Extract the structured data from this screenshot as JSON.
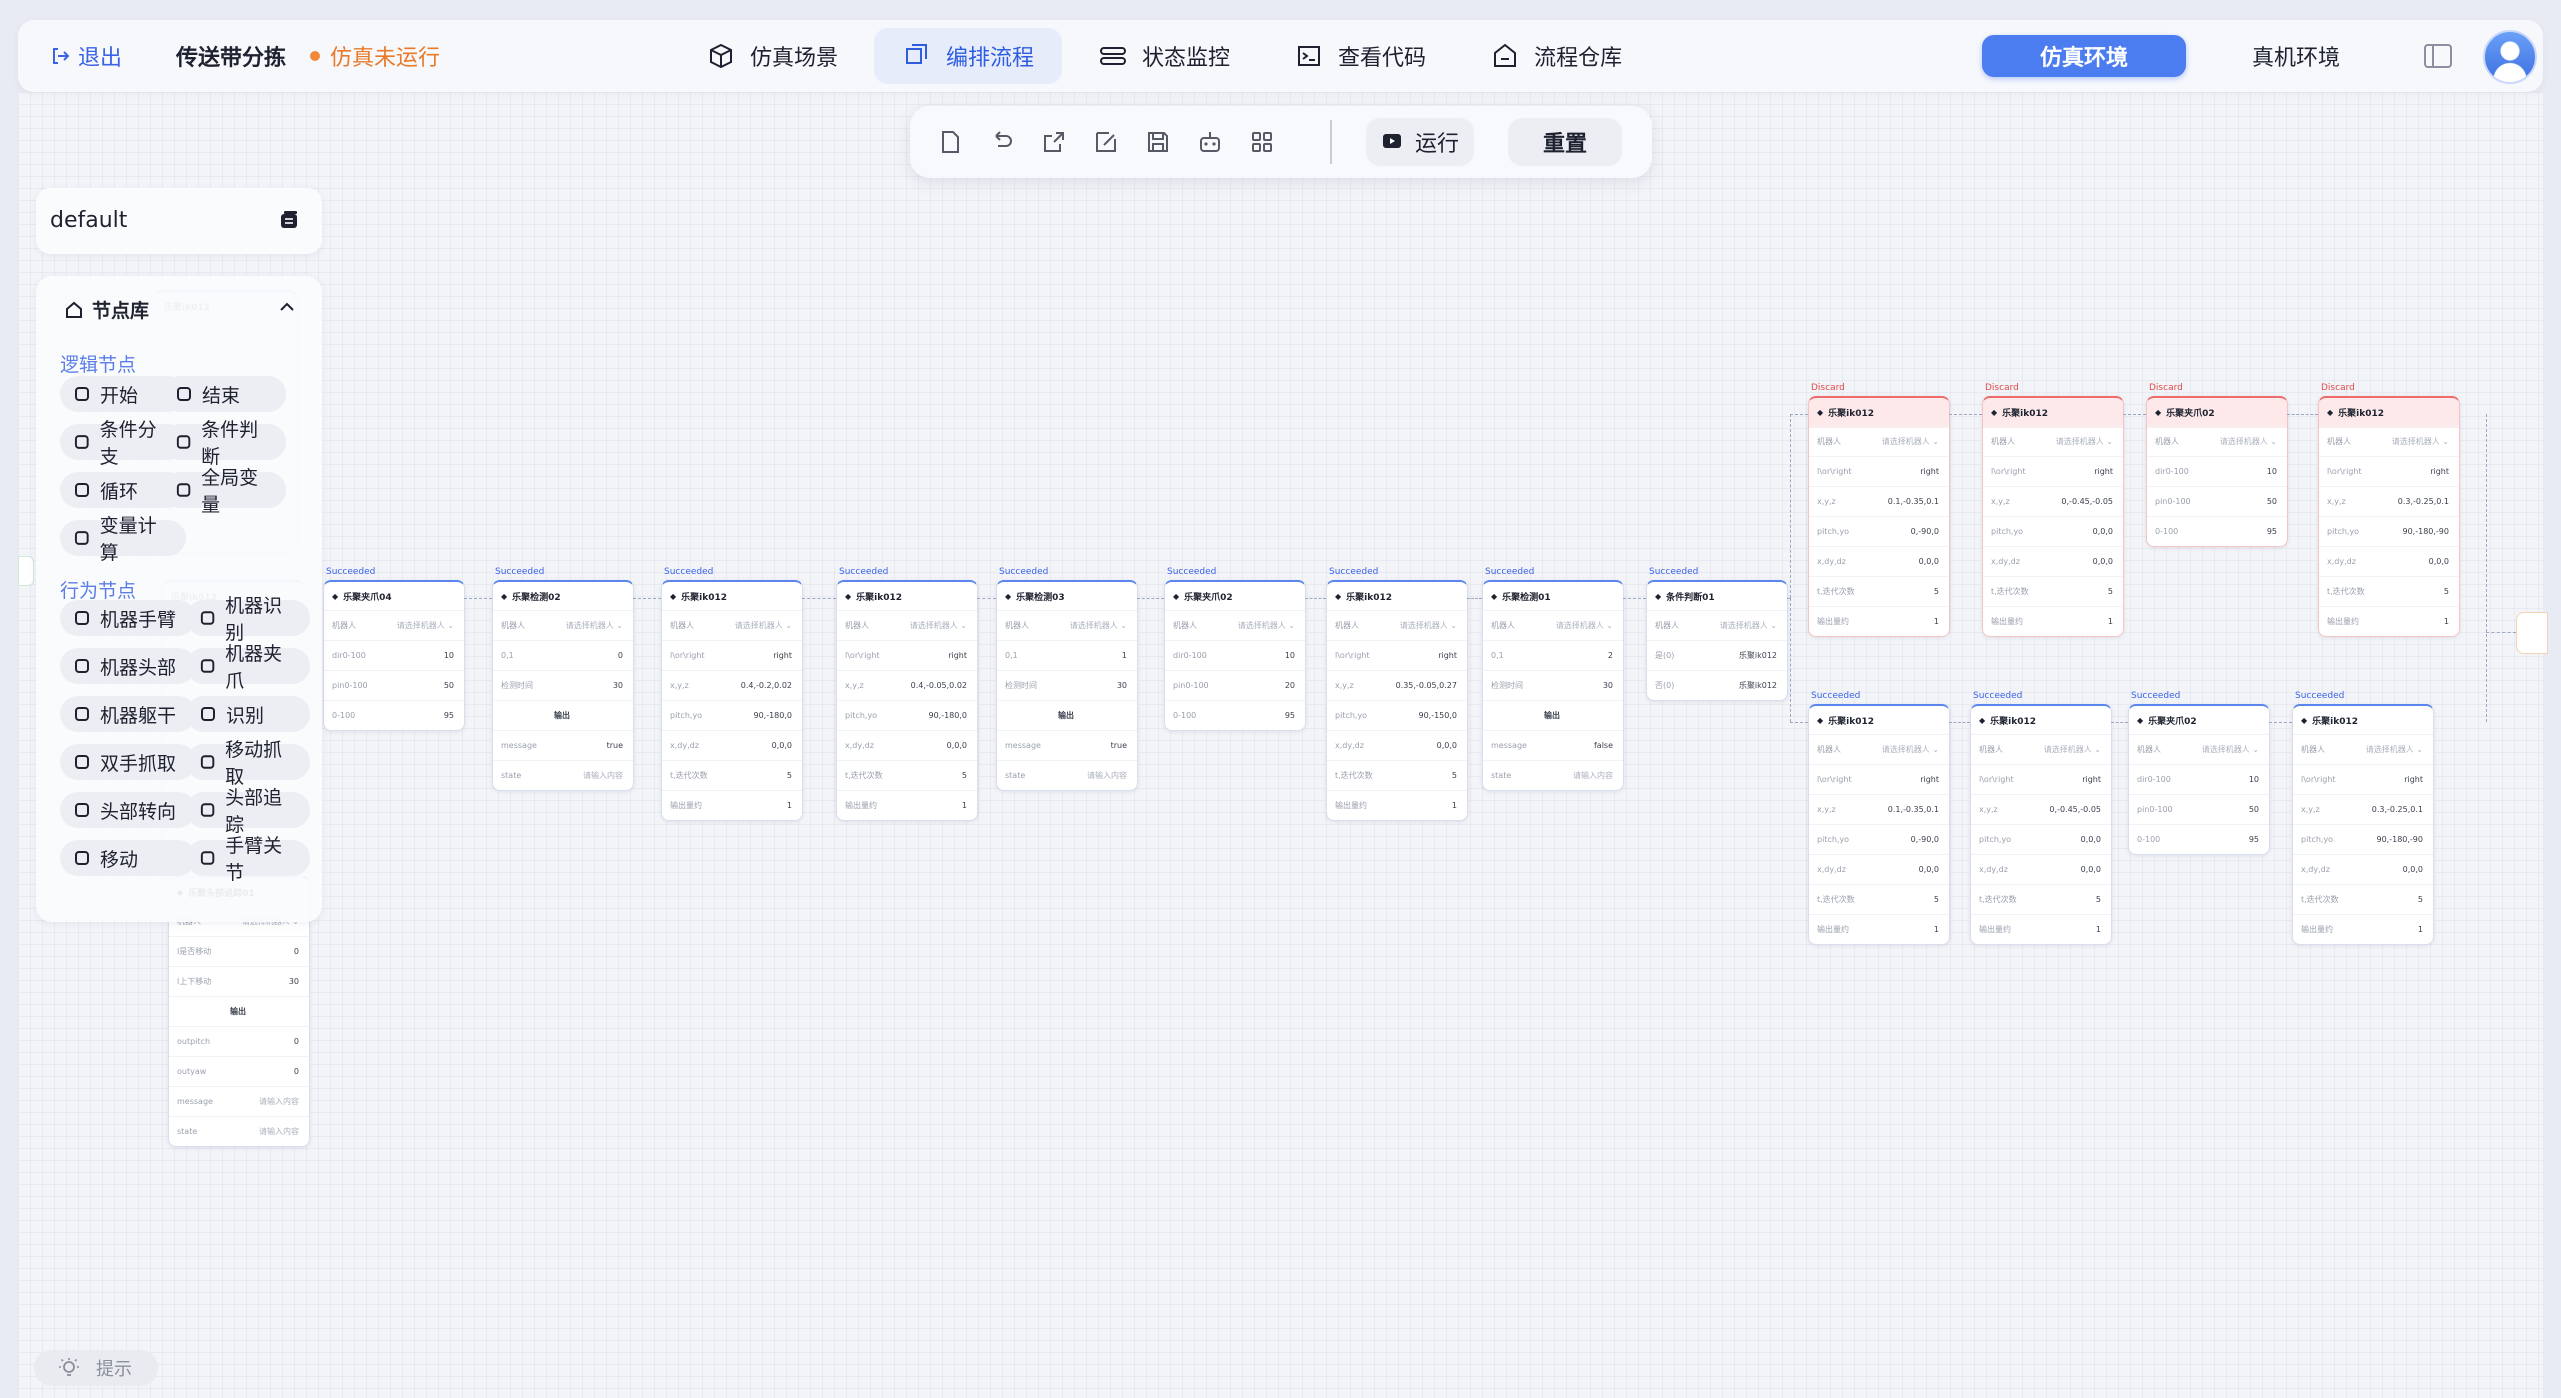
{
  "header": {
    "exit_label": "退出",
    "project_title": "传送带分拣",
    "status_text": "仿真未运行",
    "status_color": "#ea7a29",
    "nav": [
      {
        "label": "仿真场景",
        "icon": "cube-icon",
        "active": false
      },
      {
        "label": "编排流程",
        "icon": "flow-icon",
        "active": true
      },
      {
        "label": "状态监控",
        "icon": "monitor-icon",
        "active": false
      },
      {
        "label": "查看代码",
        "icon": "terminal-icon",
        "active": false
      },
      {
        "label": "流程仓库",
        "icon": "repo-icon",
        "active": false
      }
    ],
    "env_sim": "仿真环境",
    "env_real": "真机环境",
    "accent_color": "#4b7cf0"
  },
  "toolbar": {
    "icons": [
      "new-file-icon",
      "undo-icon",
      "export-icon",
      "edit-icon",
      "save-icon",
      "robot-icon",
      "grid-icon"
    ],
    "run_label": "运行",
    "reset_label": "重置"
  },
  "workspace": {
    "name": "default"
  },
  "library": {
    "title": "节点库",
    "logic_section": "逻辑节点",
    "logic_nodes": [
      "开始",
      "结束",
      "条件分支",
      "条件判断",
      "循环",
      "全局变量",
      "变量计算"
    ],
    "action_section": "行为节点",
    "action_nodes": [
      "机器手臂",
      "机器识别",
      "机器头部",
      "机器夹爪",
      "机器躯干",
      "识别",
      "双手抓取",
      "移动抓取",
      "头部转向",
      "头部追踪",
      "移动",
      "手臂关节"
    ]
  },
  "hint_label": "提示",
  "flow": {
    "succeeded": "Succeeded",
    "discard": "Discard",
    "output_label": "输出",
    "robot_label": "机器人",
    "robot_placeholder": "请选择机器人",
    "input_placeholder": "请输入内容",
    "nodes": [
      {
        "title": "乐聚夹爪04",
        "rows": [
          [
            "dir0-100",
            "10"
          ],
          [
            "pin0-100",
            "50"
          ],
          [
            "0-100",
            "95"
          ]
        ]
      },
      {
        "title": "乐聚检测02",
        "rows": [
          [
            "0,1",
            "0"
          ],
          [
            "检测时间",
            "30"
          ]
        ],
        "output": [
          [
            "message",
            "true"
          ],
          [
            "state",
            "请输入内容"
          ]
        ]
      },
      {
        "title": "乐聚ik012",
        "rows": [
          [
            "l\\or\\right",
            "right"
          ],
          [
            "x,y,z",
            "0.4,-0.2,0.02"
          ],
          [
            "pitch,yo",
            "90,-180,0"
          ],
          [
            "x,dy,dz",
            "0,0,0"
          ],
          [
            "t,迭代次数",
            "5"
          ],
          [
            "输出量约",
            "1"
          ]
        ]
      },
      {
        "title": "乐聚ik012",
        "rows": [
          [
            "l\\or\\right",
            "right"
          ],
          [
            "x,y,z",
            "0.4,-0.05,0.02"
          ],
          [
            "pitch,yo",
            "90,-180,0"
          ],
          [
            "x,dy,dz",
            "0,0,0"
          ],
          [
            "t,迭代次数",
            "5"
          ],
          [
            "输出量约",
            "1"
          ]
        ]
      },
      {
        "title": "乐聚检测03",
        "rows": [
          [
            "0,1",
            "1"
          ],
          [
            "检测时间",
            "30"
          ]
        ],
        "output": [
          [
            "message",
            "true"
          ],
          [
            "state",
            "请输入内容"
          ]
        ]
      },
      {
        "title": "乐聚夹爪02",
        "rows": [
          [
            "dir0-100",
            "10"
          ],
          [
            "pin0-100",
            "20"
          ],
          [
            "0-100",
            "95"
          ]
        ]
      },
      {
        "title": "乐聚ik012",
        "rows": [
          [
            "l\\or\\right",
            "right"
          ],
          [
            "x,y,z",
            "0.35,-0.05,0.27"
          ],
          [
            "pitch,yo",
            "90,-150,0"
          ],
          [
            "x,dy,dz",
            "0,0,0"
          ],
          [
            "t,迭代次数",
            "5"
          ],
          [
            "输出量约",
            "1"
          ]
        ]
      },
      {
        "title": "乐聚检测01",
        "rows": [
          [
            "0,1",
            "2"
          ],
          [
            "检测时间",
            "30"
          ]
        ],
        "output": [
          [
            "message",
            "false"
          ],
          [
            "state",
            "请输入内容"
          ]
        ]
      },
      {
        "title": "条件判断01",
        "rows": [
          [
            "是(0)",
            "乐聚ik012"
          ],
          [
            "否(0)",
            "乐聚ik012"
          ]
        ]
      }
    ],
    "branch_discard": [
      {
        "title": "乐聚ik012",
        "rows": [
          [
            "l\\or\\right",
            "right"
          ],
          [
            "x,y,z",
            "0.1,-0.35,0.1"
          ],
          [
            "pitch,yo",
            "0,-90,0"
          ],
          [
            "x,dy,dz",
            "0,0,0"
          ],
          [
            "t,迭代次数",
            "5"
          ],
          [
            "输出量约",
            "1"
          ]
        ]
      },
      {
        "title": "乐聚ik012",
        "rows": [
          [
            "l\\or\\right",
            "right"
          ],
          [
            "x,y,z",
            "0,-0.45,-0.05"
          ],
          [
            "pitch,yo",
            "0,0,0"
          ],
          [
            "x,dy,dz",
            "0,0,0"
          ],
          [
            "t,迭代次数",
            "5"
          ],
          [
            "输出量约",
            "1"
          ]
        ]
      },
      {
        "title": "乐聚夹爪02",
        "rows": [
          [
            "dir0-100",
            "10"
          ],
          [
            "pin0-100",
            "50"
          ],
          [
            "0-100",
            "95"
          ]
        ]
      },
      {
        "title": "乐聚ik012",
        "rows": [
          [
            "l\\or\\right",
            "right"
          ],
          [
            "x,y,z",
            "0.3,-0.25,0.1"
          ],
          [
            "pitch,yo",
            "90,-180,-90"
          ],
          [
            "x,dy,dz",
            "0,0,0"
          ],
          [
            "t,迭代次数",
            "5"
          ],
          [
            "输出量约",
            "1"
          ]
        ]
      }
    ],
    "branch_success": [
      {
        "title": "乐聚ik012",
        "rows": [
          [
            "l\\or\\right",
            "right"
          ],
          [
            "x,y,z",
            "0.1,-0.35,0.1"
          ],
          [
            "pitch,yo",
            "0,-90,0"
          ],
          [
            "x,dy,dz",
            "0,0,0"
          ],
          [
            "t,迭代次数",
            "5"
          ],
          [
            "输出量约",
            "1"
          ]
        ]
      },
      {
        "title": "乐聚ik012",
        "rows": [
          [
            "l\\or\\right",
            "right"
          ],
          [
            "x,y,z",
            "0,-0.45,-0.05"
          ],
          [
            "pitch,yo",
            "0,0,0"
          ],
          [
            "x,dy,dz",
            "0,0,0"
          ],
          [
            "t,迭代次数",
            "5"
          ],
          [
            "输出量约",
            "1"
          ]
        ]
      },
      {
        "title": "乐聚夹爪02",
        "rows": [
          [
            "dir0-100",
            "10"
          ],
          [
            "pin0-100",
            "50"
          ],
          [
            "0-100",
            "95"
          ]
        ]
      },
      {
        "title": "乐聚ik012",
        "rows": [
          [
            "l\\or\\right",
            "right"
          ],
          [
            "x,y,z",
            "0.3,-0.25,0.1"
          ],
          [
            "pitch,yo",
            "90,-180,-90"
          ],
          [
            "x,dy,dz",
            "0,0,0"
          ],
          [
            "t,迭代次数",
            "5"
          ],
          [
            "输出量约",
            "1"
          ]
        ]
      }
    ],
    "left_hidden": {
      "title": "乐聚头部追踪01",
      "rows": [
        [
          "l是否移动",
          "0"
        ],
        [
          "l上下移动",
          "30"
        ]
      ],
      "output": [
        [
          "outpitch",
          "0"
        ],
        [
          "outyaw",
          "0"
        ],
        [
          "message",
          "请输入内容"
        ],
        [
          "state",
          "请输入内容"
        ]
      ]
    },
    "behind_lib": [
      {
        "title": "乐聚ik012"
      },
      {
        "title": "乐聚ik012"
      }
    ]
  }
}
